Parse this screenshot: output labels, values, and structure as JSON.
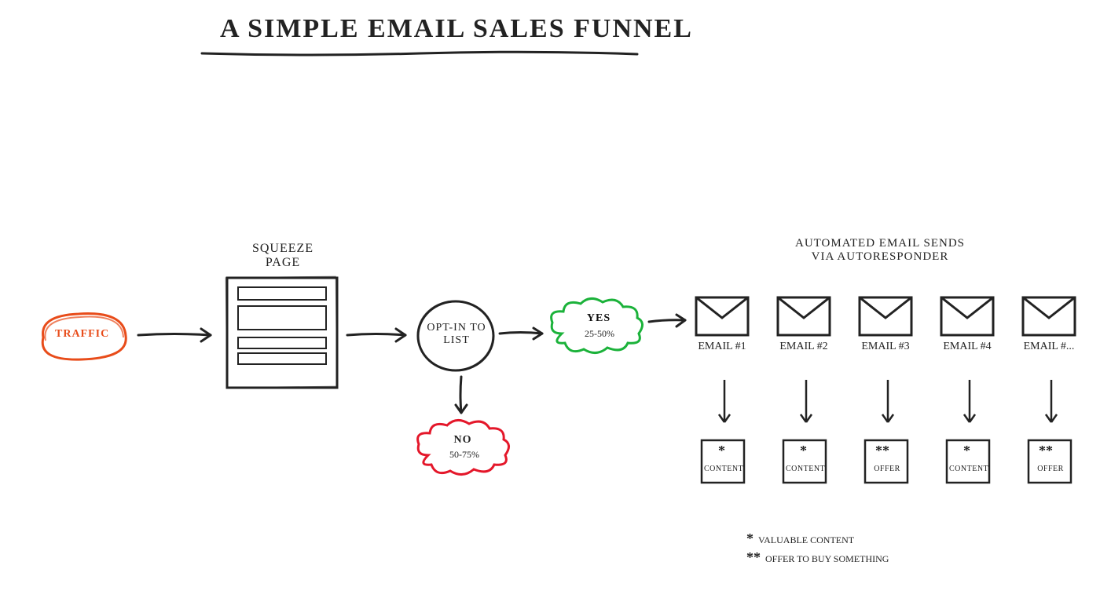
{
  "title": "A SIMPLE EMAIL SALES FUNNEL",
  "traffic": "TRAFFIC",
  "squeeze": "SQUEEZE PAGE",
  "optin": "OPT-IN TO LIST",
  "yes": {
    "label": "YES",
    "sub": "25-50%"
  },
  "no": {
    "label": "NO",
    "sub": "50-75%"
  },
  "autoresponder": "AUTOMATED EMAIL SENDS VIA AUTORESPONDER",
  "emails": [
    {
      "label": "EMAIL #1",
      "stars": "*",
      "box": "CONTENT"
    },
    {
      "label": "EMAIL #2",
      "stars": "*",
      "box": "CONTENT"
    },
    {
      "label": "EMAIL #3",
      "stars": "**",
      "box": "OFFER"
    },
    {
      "label": "EMAIL #4",
      "stars": "*",
      "box": "CONTENT"
    },
    {
      "label": "EMAIL #...",
      "stars": "**",
      "box": "OFFER"
    }
  ],
  "legend": {
    "one": "VALUABLE CONTENT",
    "two": "OFFER TO BUY SOMETHING",
    "sym1": "*",
    "sym2": "**"
  },
  "colors": {
    "traffic": "#e84c1a",
    "yes": "#1bb23a",
    "no": "#e4172a",
    "ink": "#222"
  }
}
